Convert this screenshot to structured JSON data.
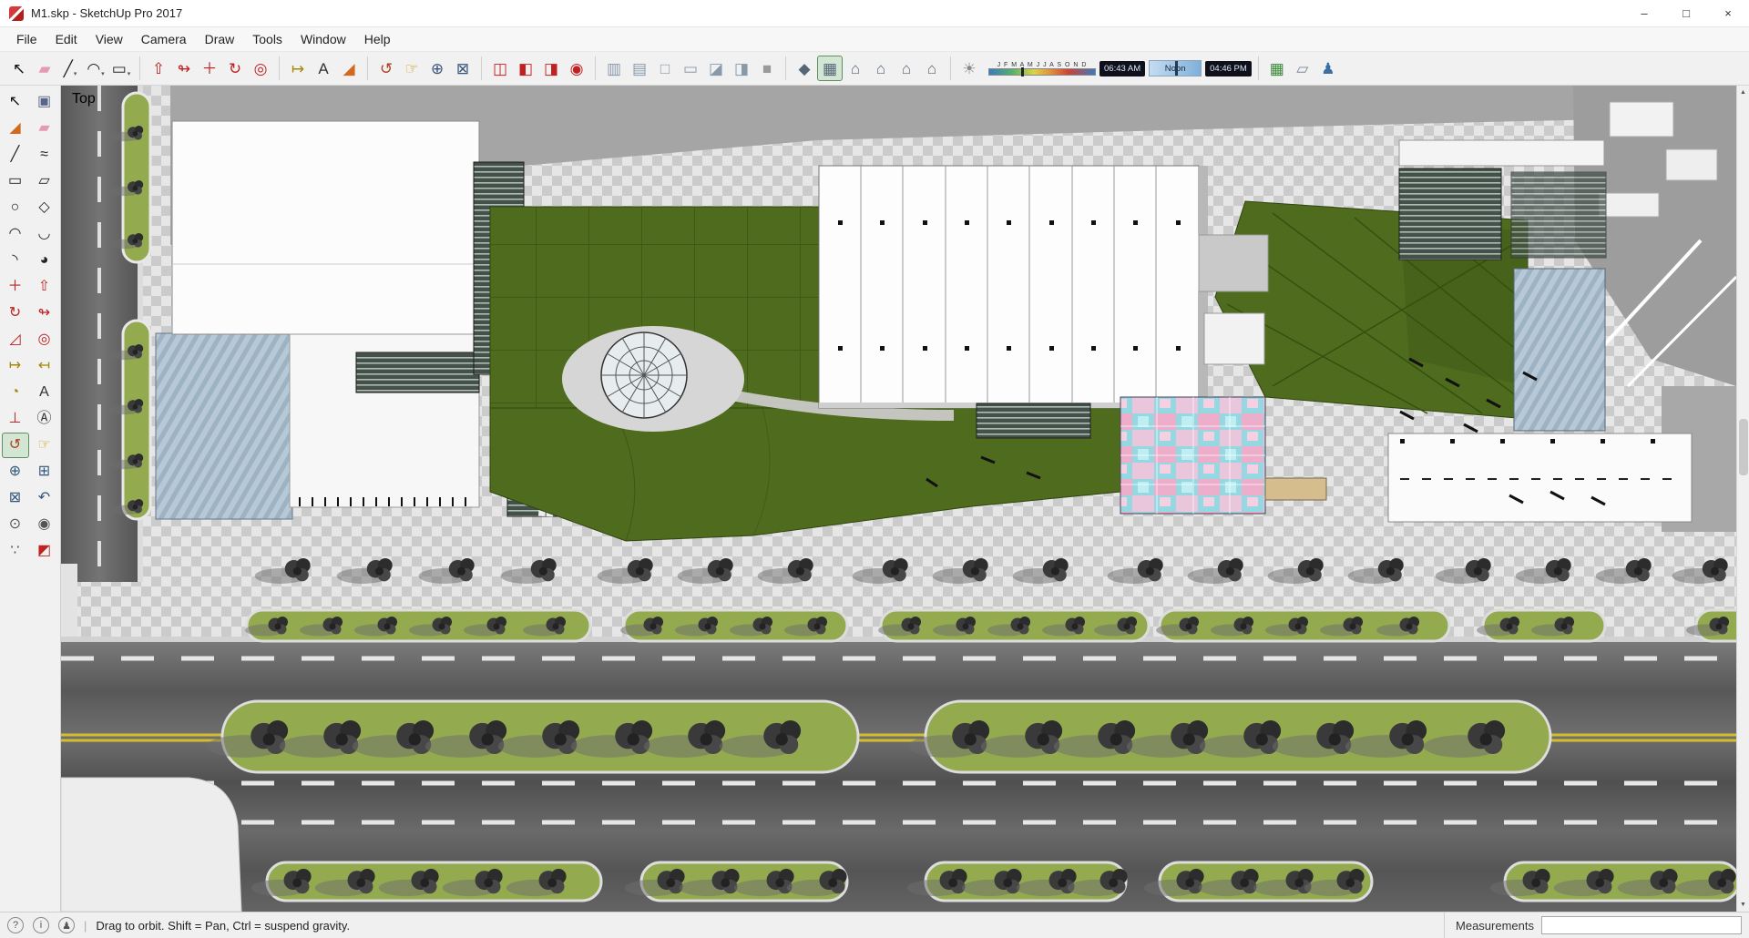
{
  "window": {
    "title": "M1.skp - SketchUp Pro 2017",
    "controls": [
      {
        "name": "minimize-button",
        "glyph": "–"
      },
      {
        "name": "maximize-button",
        "glyph": "□"
      },
      {
        "name": "close-button",
        "glyph": "×"
      }
    ]
  },
  "menu": {
    "items": [
      {
        "name": "menu-file",
        "label": "File"
      },
      {
        "name": "menu-edit",
        "label": "Edit"
      },
      {
        "name": "menu-view",
        "label": "View"
      },
      {
        "name": "menu-camera",
        "label": "Camera"
      },
      {
        "name": "menu-draw",
        "label": "Draw"
      },
      {
        "name": "menu-tools",
        "label": "Tools"
      },
      {
        "name": "menu-window",
        "label": "Window"
      },
      {
        "name": "menu-help",
        "label": "Help"
      }
    ]
  },
  "toolbar": {
    "groups": {
      "principal": [
        {
          "name": "select-tool",
          "glyph": "↖",
          "color": "#111111"
        },
        {
          "name": "eraser-tool",
          "glyph": "▰",
          "color": "#e39bb4"
        },
        {
          "name": "line-tool",
          "glyph": "╱",
          "color": "#222222",
          "dd": true
        },
        {
          "name": "arc-tool",
          "glyph": "◠",
          "color": "#222222",
          "dd": true
        },
        {
          "name": "shapes-tool",
          "glyph": "▭",
          "color": "#222222",
          "dd": true
        }
      ],
      "edit": [
        {
          "name": "push-pull-tool",
          "glyph": "⇧",
          "color": "#c02222"
        },
        {
          "name": "follow-me-tool",
          "glyph": "↬",
          "color": "#c02222"
        },
        {
          "name": "move-tool",
          "glyph": "＋",
          "color": "#c02222"
        },
        {
          "name": "rotate-tool",
          "glyph": "↻",
          "color": "#c02222"
        },
        {
          "name": "offset-tool",
          "glyph": "◎",
          "color": "#c02222"
        }
      ],
      "construction": [
        {
          "name": "tape-measure-tool",
          "glyph": "↦",
          "color": "#a8860b"
        },
        {
          "name": "text-tool",
          "glyph": "A",
          "color": "#333333"
        },
        {
          "name": "paint-bucket-tool",
          "glyph": "◢",
          "color": "#d2691e"
        }
      ],
      "camera": [
        {
          "name": "orbit-tool",
          "glyph": "↺",
          "color": "#b04020"
        },
        {
          "name": "pan-tool",
          "glyph": "☞",
          "color": "#c8a018"
        },
        {
          "name": "zoom-tool",
          "glyph": "⊕",
          "color": "#33557a"
        },
        {
          "name": "zoom-extents-tool",
          "glyph": "⊠",
          "color": "#33557a"
        }
      ],
      "section": [
        {
          "name": "section-plane-tool",
          "glyph": "◫",
          "color": "#c02222"
        },
        {
          "name": "display-section-planes-tool",
          "glyph": "◧",
          "color": "#c02222"
        },
        {
          "name": "display-section-cuts-tool",
          "glyph": "◨",
          "color": "#c02222"
        },
        {
          "name": "section-fill-tool",
          "glyph": "◉",
          "color": "#c02222"
        }
      ],
      "styles": [
        {
          "name": "style-xray",
          "glyph": "▥",
          "color": "#8899aa"
        },
        {
          "name": "style-back-edges",
          "glyph": "▤",
          "color": "#8899aa"
        },
        {
          "name": "style-wireframe",
          "glyph": "□",
          "color": "#8899aa"
        },
        {
          "name": "style-hidden-line",
          "glyph": "▭",
          "color": "#8899aa"
        },
        {
          "name": "style-shaded",
          "glyph": "◪",
          "color": "#8899aa"
        },
        {
          "name": "style-shaded-textures",
          "glyph": "◨",
          "color": "#8899aa"
        },
        {
          "name": "style-monochrome",
          "glyph": "■",
          "color": "#9a9a9a"
        }
      ],
      "views": [
        {
          "name": "view-iso",
          "glyph": "◆",
          "color": "#556677"
        },
        {
          "name": "view-top",
          "glyph": "▦",
          "color": "#556677",
          "active": true
        },
        {
          "name": "view-front",
          "glyph": "⌂",
          "color": "#556677"
        },
        {
          "name": "view-right",
          "glyph": "⌂",
          "color": "#556677"
        },
        {
          "name": "view-back",
          "glyph": "⌂",
          "color": "#556677"
        },
        {
          "name": "view-left",
          "glyph": "⌂",
          "color": "#556677"
        }
      ],
      "shadow_toggle": [
        {
          "name": "shadows-toggle",
          "glyph": "☀",
          "color": "#888888"
        }
      ],
      "panels": [
        {
          "name": "warehouse-icon",
          "glyph": "▦",
          "color": "#3a8a3a"
        },
        {
          "name": "tags-icon",
          "glyph": "▱",
          "color": "#778899"
        },
        {
          "name": "sign-in-icon",
          "glyph": "♟",
          "color": "#3a6ea5"
        }
      ]
    },
    "shadow": {
      "months": "J F M A M J J A S O N D",
      "time_start": "06:43 AM",
      "noon_label": "Noon",
      "time_end": "04:46 PM"
    }
  },
  "left_toolbar": {
    "items": [
      {
        "name": "select-tool",
        "glyph": "↖",
        "color": "#111111"
      },
      {
        "name": "make-component-tool",
        "glyph": "▣",
        "color": "#556688"
      },
      {
        "name": "paint-bucket-tool",
        "glyph": "◢",
        "color": "#d2691e"
      },
      {
        "name": "eraser-tool",
        "glyph": "▰",
        "color": "#e39bb4"
      },
      {
        "name": "line-tool",
        "glyph": "╱",
        "color": "#222222"
      },
      {
        "name": "freehand-tool",
        "glyph": "≈",
        "color": "#222222"
      },
      {
        "name": "rectangle-tool",
        "glyph": "▭",
        "color": "#222222"
      },
      {
        "name": "rotated-rectangle-tool",
        "glyph": "▱",
        "color": "#222222"
      },
      {
        "name": "circle-tool",
        "glyph": "○",
        "color": "#222222"
      },
      {
        "name": "polygon-tool",
        "glyph": "◇",
        "color": "#222222"
      },
      {
        "name": "arc-tool",
        "glyph": "◠",
        "color": "#222222"
      },
      {
        "name": "two-point-arc-tool",
        "glyph": "◡",
        "color": "#222222"
      },
      {
        "name": "three-point-arc-tool",
        "glyph": "◝",
        "color": "#222222"
      },
      {
        "name": "pie-tool",
        "glyph": "◕",
        "color": "#222222"
      },
      {
        "name": "move-tool",
        "glyph": "＋",
        "color": "#c02222"
      },
      {
        "name": "push-pull-tool",
        "glyph": "⇧",
        "color": "#c02222"
      },
      {
        "name": "rotate-tool",
        "glyph": "↻",
        "color": "#c02222"
      },
      {
        "name": "follow-me-tool",
        "glyph": "↬",
        "color": "#c02222"
      },
      {
        "name": "scale-tool",
        "glyph": "◿",
        "color": "#c02222"
      },
      {
        "name": "offset-tool",
        "glyph": "◎",
        "color": "#c02222"
      },
      {
        "name": "tape-measure-tool",
        "glyph": "↦",
        "color": "#a8860b"
      },
      {
        "name": "dimension-tool",
        "glyph": "↤",
        "color": "#a8860b"
      },
      {
        "name": "protractor-tool",
        "glyph": "◔",
        "color": "#a8860b"
      },
      {
        "name": "text-tool",
        "glyph": "A",
        "color": "#333333"
      },
      {
        "name": "axes-tool",
        "glyph": "⊥",
        "color": "#c02222"
      },
      {
        "name": "3d-text-tool",
        "glyph": "Ⓐ",
        "color": "#333333"
      },
      {
        "name": "orbit-tool",
        "glyph": "↺",
        "color": "#b04020",
        "active": true
      },
      {
        "name": "pan-tool",
        "glyph": "☞",
        "color": "#c8a018"
      },
      {
        "name": "zoom-tool",
        "glyph": "⊕",
        "color": "#33557a"
      },
      {
        "name": "zoom-window-tool",
        "glyph": "⊞",
        "color": "#33557a"
      },
      {
        "name": "zoom-extents-tool",
        "glyph": "⊠",
        "color": "#33557a"
      },
      {
        "name": "previous-view-tool",
        "glyph": "↶",
        "color": "#33557a"
      },
      {
        "name": "position-camera-tool",
        "glyph": "⊙",
        "color": "#555555"
      },
      {
        "name": "look-around-tool",
        "glyph": "◉",
        "color": "#555555"
      },
      {
        "name": "walk-tool",
        "glyph": "∵",
        "color": "#555555"
      },
      {
        "name": "section-plane-tool",
        "glyph": "◩",
        "color": "#c02222"
      }
    ]
  },
  "viewport": {
    "view_label": "Top",
    "colors": {
      "roof-green": "#4f6b1e",
      "median-green": "#93aa4e",
      "road-gray": "#5c5c5c",
      "glass-blue": "#b7c9d6",
      "texture-cyan": "#96d8e2",
      "texture-pink": "#ecaeca"
    }
  },
  "scrollbar": {
    "up": "▲",
    "down": "▼"
  },
  "status": {
    "icons": [
      {
        "name": "help-icon",
        "glyph": "?"
      },
      {
        "name": "geolocation-icon",
        "glyph": "i"
      },
      {
        "name": "account-icon",
        "glyph": "♟"
      }
    ],
    "hint": "Drag to orbit. Shift = Pan, Ctrl = suspend gravity.",
    "measurements_label": "Measurements",
    "measurements_value": ""
  }
}
